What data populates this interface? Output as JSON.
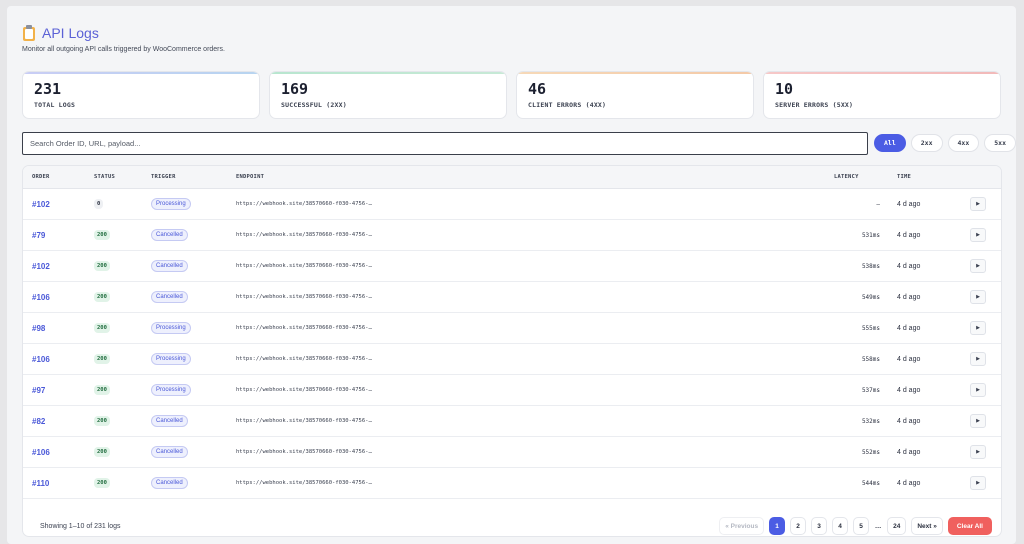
{
  "header": {
    "title": "API Logs",
    "subtitle": "Monitor all outgoing API calls triggered by WooCommerce orders."
  },
  "stats": [
    {
      "value": "231",
      "label": "TOTAL LOGS"
    },
    {
      "value": "169",
      "label": "SUCCESSFUL (2XX)"
    },
    {
      "value": "46",
      "label": "CLIENT ERRORS (4XX)"
    },
    {
      "value": "10",
      "label": "SERVER ERRORS (5XX)"
    }
  ],
  "search": {
    "placeholder": "Search Order ID, URL, payload...",
    "value": ""
  },
  "filters": [
    {
      "label": "All",
      "active": true
    },
    {
      "label": "2xx",
      "active": false
    },
    {
      "label": "4xx",
      "active": false
    },
    {
      "label": "5xx",
      "active": false
    }
  ],
  "table": {
    "columns": {
      "order": "ORDER",
      "status": "STATUS",
      "trigger": "TRIGGER",
      "endpoint": "ENDPOINT",
      "latency": "LATENCY",
      "time": "TIME"
    },
    "rows": [
      {
        "order": "#102",
        "status": "0",
        "trigger": "Processing",
        "endpoint": "https://webhook.site/38570660-f030-4756-…",
        "latency": "–",
        "time": "4 d ago",
        "action": "▶"
      },
      {
        "order": "#79",
        "status": "200",
        "trigger": "Cancelled",
        "endpoint": "https://webhook.site/38570660-f030-4756-…",
        "latency": "531ms",
        "time": "4 d ago",
        "action": "▶"
      },
      {
        "order": "#102",
        "status": "200",
        "trigger": "Cancelled",
        "endpoint": "https://webhook.site/38570660-f030-4756-…",
        "latency": "538ms",
        "time": "4 d ago",
        "action": "▶"
      },
      {
        "order": "#106",
        "status": "200",
        "trigger": "Cancelled",
        "endpoint": "https://webhook.site/38570660-f030-4756-…",
        "latency": "549ms",
        "time": "4 d ago",
        "action": "▶"
      },
      {
        "order": "#98",
        "status": "200",
        "trigger": "Processing",
        "endpoint": "https://webhook.site/38570660-f030-4756-…",
        "latency": "555ms",
        "time": "4 d ago",
        "action": "▶"
      },
      {
        "order": "#106",
        "status": "200",
        "trigger": "Processing",
        "endpoint": "https://webhook.site/38570660-f030-4756-…",
        "latency": "558ms",
        "time": "4 d ago",
        "action": "▶"
      },
      {
        "order": "#97",
        "status": "200",
        "trigger": "Processing",
        "endpoint": "https://webhook.site/38570660-f030-4756-…",
        "latency": "537ms",
        "time": "4 d ago",
        "action": "▶"
      },
      {
        "order": "#82",
        "status": "200",
        "trigger": "Cancelled",
        "endpoint": "https://webhook.site/38570660-f030-4756-…",
        "latency": "532ms",
        "time": "4 d ago",
        "action": "▶"
      },
      {
        "order": "#106",
        "status": "200",
        "trigger": "Cancelled",
        "endpoint": "https://webhook.site/38570660-f030-4756-…",
        "latency": "552ms",
        "time": "4 d ago",
        "action": "▶"
      },
      {
        "order": "#110",
        "status": "200",
        "trigger": "Cancelled",
        "endpoint": "https://webhook.site/38570660-f030-4756-…",
        "latency": "544ms",
        "time": "4 d ago",
        "action": "▶"
      }
    ]
  },
  "footer": {
    "info": "Showing 1–10 of 231 logs",
    "previous": "« Previous",
    "pages": [
      "1",
      "2",
      "3",
      "4",
      "5"
    ],
    "ellipsis": "…",
    "last_page": "24",
    "next": "Next »",
    "clear": "Clear All",
    "current_page": 1
  },
  "colors": {
    "accent": "#4b5ce4",
    "danger": "#f0605e",
    "success_badge": "#e1f3e8"
  }
}
